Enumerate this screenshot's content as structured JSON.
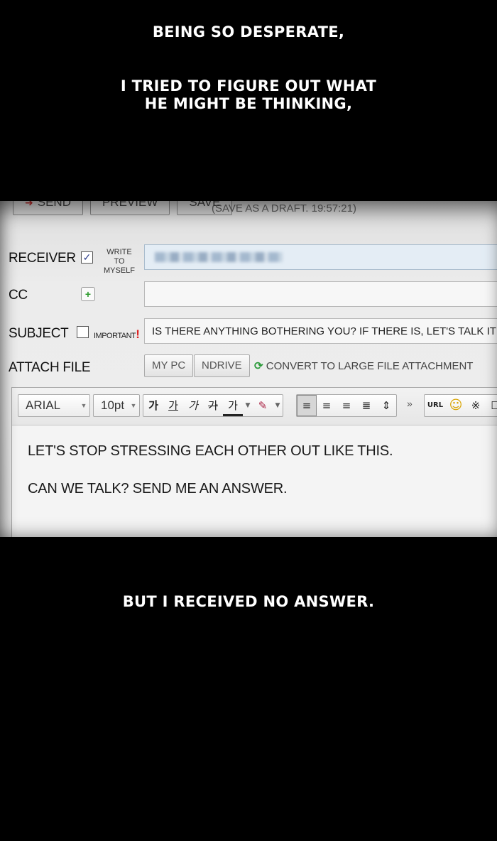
{
  "captions": {
    "top": "BEING SO DESPERATE,",
    "middle_line1": "I TRIED TO FIGURE OUT WHAT",
    "middle_line2": "HE MIGHT BE THINKING,",
    "bottom": "BUT I RECEIVED NO ANSWER."
  },
  "toolbar": {
    "send_label": "SEND",
    "preview_label": "PREVIEW",
    "save_label": "SAVE",
    "draft_note": "(SAVE AS A DRAFT. 19:57:21)"
  },
  "form": {
    "receiver_label": "RECEIVER",
    "write_to_myself_line1": "WRITE",
    "write_to_myself_line2": "TO MYSELF",
    "write_to_myself_checked": true,
    "cc_label": "CC",
    "subject_label": "SUBJECT",
    "important_label": "IMPORTANT",
    "important_mark": "!",
    "important_checked": false,
    "subject_value": "IS THERE ANYTHING BOTHERING YOU? IF THERE IS, LET'S TALK IT OUT",
    "attach_label": "ATTACH FILE",
    "my_pc_label": "MY PC",
    "ndrive_label": "NDRIVE",
    "convert_label": "CONVERT TO LARGE FILE ATTACHMENT"
  },
  "editor": {
    "font": "ARIAL",
    "size": "10pt",
    "format_buttons": [
      "가",
      "가",
      "가",
      "가",
      "가"
    ],
    "more": "»",
    "url": "URL",
    "body_line1": "LET'S STOP STRESSING EACH OTHER OUT LIKE THIS.",
    "body_line2": "CAN WE TALK? SEND ME AN ANSWER."
  },
  "colors": {
    "background": "#000000",
    "caption": "#ffffff",
    "panel": "#ececec",
    "important_mark": "#dd2222",
    "convert_icon": "#2b9a3a"
  }
}
